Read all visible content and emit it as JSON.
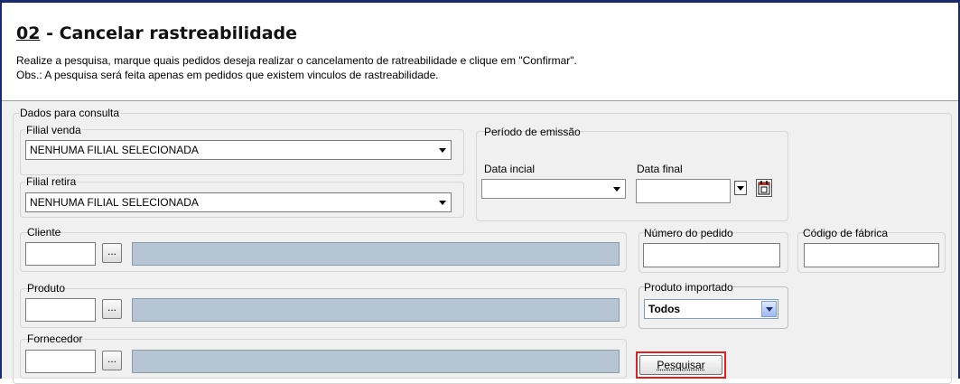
{
  "header": {
    "title_number": "02",
    "title_sep": " - ",
    "title_text": "Cancelar rastreabilidade",
    "description": "Realize a pesquisa, marque quais pedidos deseja realizar o cancelamento de ratreabilidade e clique em \"Confirmar\".",
    "observation": "Obs.: A pesquisa será feita apenas em pedidos que existem vinculos de rastreabilidade."
  },
  "form": {
    "group_label": "Dados para consulta",
    "filial_venda": {
      "label": "Filial venda",
      "value": "NENHUMA FILIAL SELECIONADA"
    },
    "filial_retira": {
      "label": "Filial retira",
      "value": "NENHUMA FILIAL SELECIONADA"
    },
    "periodo": {
      "label": "Período de emissão",
      "data_inicial_label": "Data incial",
      "data_inicial_value": "",
      "data_final_label": "Data final",
      "data_final_value": ""
    },
    "cliente": {
      "label": "Cliente",
      "code": "",
      "name": "",
      "lookup_label": "..."
    },
    "produto": {
      "label": "Produto",
      "code": "",
      "name": "",
      "lookup_label": "..."
    },
    "fornecedor": {
      "label": "Fornecedor",
      "code": "",
      "name": "",
      "lookup_label": "..."
    },
    "numero_pedido": {
      "label": "Número do pedido",
      "value": ""
    },
    "codigo_fabrica": {
      "label": "Código de fábrica",
      "value": ""
    },
    "produto_importado": {
      "label": "Produto importado",
      "value": "Todos"
    },
    "search_label": "Pesquisar"
  },
  "colors": {
    "frame": "#1a2a6c",
    "highlight": "#e02020",
    "readonly_field": "#b5c5d3"
  },
  "icons": [
    "calendar-icon",
    "dropdown-arrow-icon",
    "ellipsis-icon"
  ]
}
